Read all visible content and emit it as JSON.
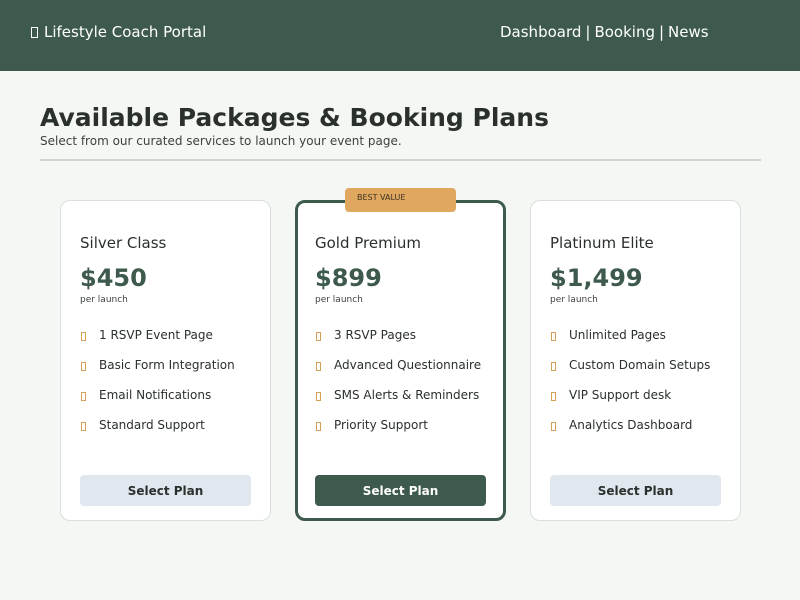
{
  "header": {
    "brand_icon": "square-icon",
    "brand": "Lifestyle Coach Portal",
    "nav": [
      {
        "label": "Dashboard"
      },
      {
        "label": "Booking"
      },
      {
        "label": "News"
      }
    ],
    "nav_separator": "|"
  },
  "main": {
    "title": "Available Packages & Booking Plans",
    "subtitle": "Select from our curated services to launch your event page."
  },
  "plans": [
    {
      "name": "Silver Class",
      "price": "$450",
      "price_unit": "per launch",
      "features": [
        "1 RSVP Event Page",
        "Basic Form Integration",
        "Email Notifications",
        "Standard Support"
      ],
      "button_label": "Select Plan"
    },
    {
      "name": "Gold Premium",
      "badge": "BEST VALUE",
      "price": "$899",
      "price_unit": "per launch",
      "features": [
        "3 RSVP Pages",
        "Advanced Questionnaire",
        "SMS Alerts & Reminders",
        "Priority Support"
      ],
      "button_label": "Select Plan"
    },
    {
      "name": "Platinum Elite",
      "price": "$1,499",
      "price_unit": "per launch",
      "features": [
        "Unlimited Pages",
        "Custom Domain Setups",
        "VIP Support desk",
        "Analytics Dashboard"
      ],
      "button_label": "Select Plan"
    }
  ],
  "colors": {
    "header_bg": "#3d5a4c",
    "accent": "#3d5a4c",
    "badge": "#e0a75e",
    "check": "#d6a05a",
    "button_secondary": "#e1e7ef",
    "page_bg": "#f5f7f4"
  }
}
